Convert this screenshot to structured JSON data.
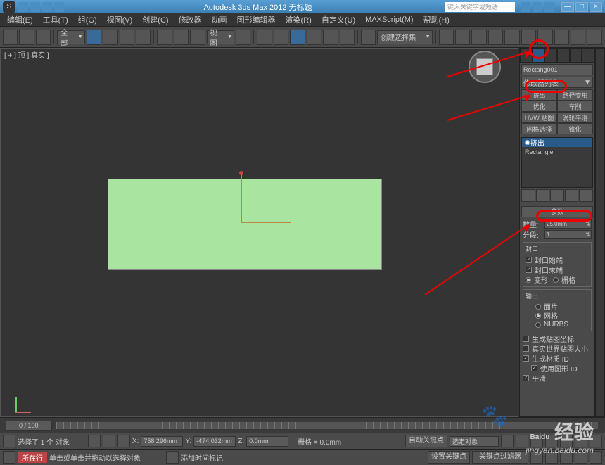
{
  "titlebar": {
    "app_title": "Autodesk 3ds Max 2012    无标题",
    "search_placeholder": "键入关键字或短语",
    "min": "—",
    "max": "□",
    "close": "×"
  },
  "menu": [
    "编辑(E)",
    "工具(T)",
    "组(G)",
    "视图(V)",
    "创建(C)",
    "修改器",
    "动画",
    "图形编辑器",
    "渲染(R)",
    "自定义(U)",
    "MAXScript(M)",
    "帮助(H)"
  ],
  "toolbar": {
    "drop_all": "全部",
    "drop_view": "视图",
    "drop_create": "创建选择集"
  },
  "viewport": {
    "label": "[ + ] 顶 ] 真实 ]"
  },
  "panel": {
    "obj_name": "Rectang001",
    "modlist": "修改器列表",
    "btns": [
      "挤出",
      "路径变形",
      "优化",
      "车削",
      "UVW 贴图",
      "涡轮平滑",
      "网格选择",
      "锥化"
    ],
    "stack": [
      "挤出",
      "Rectangle"
    ],
    "roll_params": "参数",
    "amount_lbl": "数量:",
    "amount_val": "25.0mm",
    "seg_lbl": "分段:",
    "seg_val": "1",
    "cap_title": "封口",
    "cap_start": "封口始端",
    "cap_end": "封口末端",
    "cap_morph": "变形",
    "cap_grid": "栅格",
    "out_title": "输出",
    "out_patch": "面片",
    "out_mesh": "网格",
    "out_nurbs": "NURBS",
    "gen_map": "生成贴图坐标",
    "real_world": "真实世界贴图大小",
    "gen_mat": "生成材质 ID",
    "use_shape": "使用图形 ID",
    "smooth": "平滑"
  },
  "timeline": {
    "frame": "0 / 100"
  },
  "status": {
    "sel_prompt": "选择了 1 个 对象",
    "hint": "单击或单击并拖动以选择对象",
    "add_time": "添加时间标记",
    "x": "758.296mm",
    "y": "-474.032mm",
    "z": "0.0mm",
    "grid": "栅格 = 0.0mm",
    "autokey": "自动关键点",
    "selset": "选定对象",
    "locked": "所在行",
    "setkey": "设置关键点",
    "keyfilter": "关键点过滤器"
  },
  "xlbl": "X:",
  "ylbl": "Y:",
  "zlbl": "Z:",
  "watermark": {
    "brand": "Baidu",
    "brand_cn": "经验",
    "url": "jingyan.baidu.com"
  }
}
